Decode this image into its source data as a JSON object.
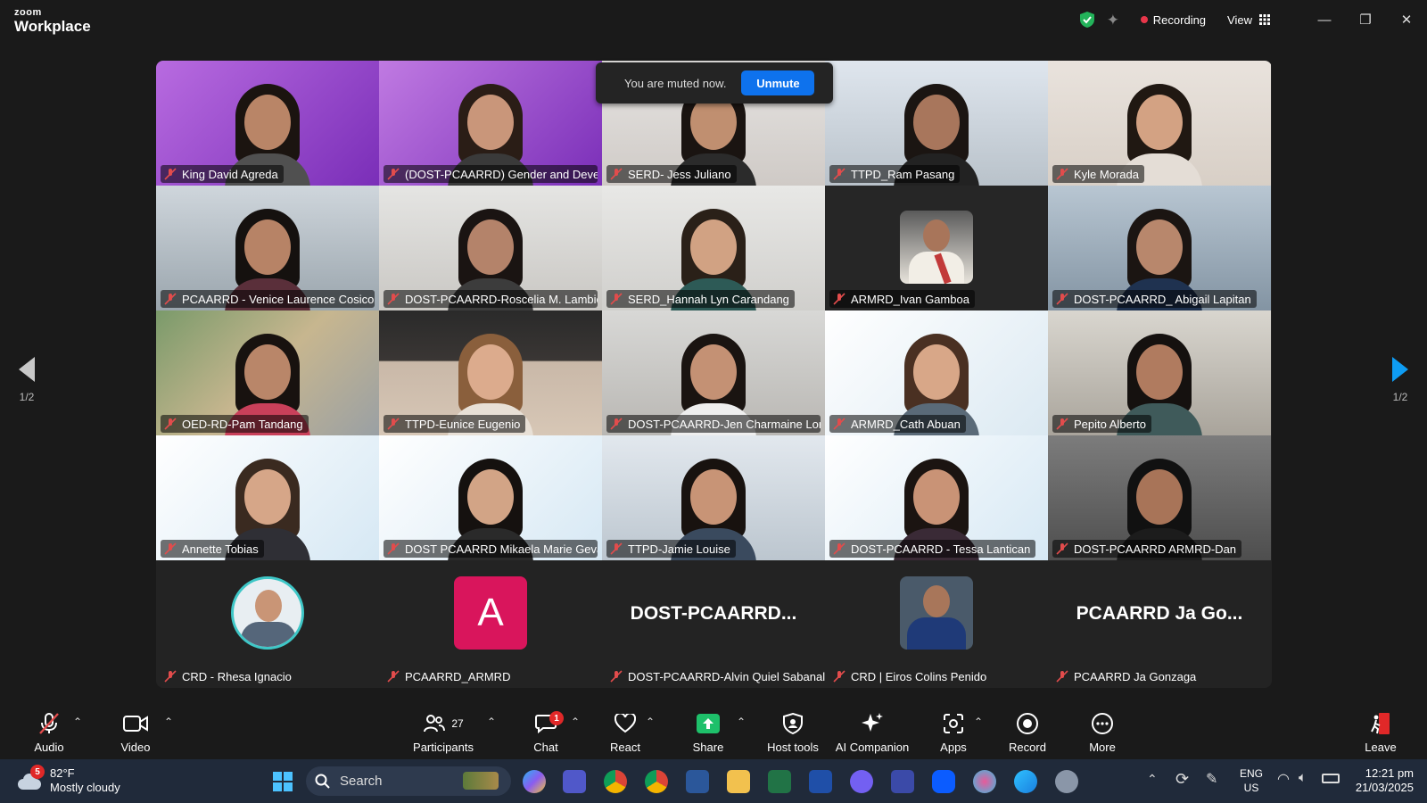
{
  "app": {
    "brand_top": "zoom",
    "brand_bottom": "Workplace",
    "recording_label": "Recording",
    "view_label": "View"
  },
  "toast": {
    "message": "You are muted now.",
    "unmute_label": "Unmute"
  },
  "pager": {
    "left_page": "1/2",
    "right_page": "1/2"
  },
  "participants": [
    {
      "name": "King David Agreda"
    },
    {
      "name": "(DOST-PCAARRD) Gender and Devel..."
    },
    {
      "name": "SERD- Jess Juliano"
    },
    {
      "name": "TTPD_Ram Pasang"
    },
    {
      "name": "Kyle Morada"
    },
    {
      "name": "PCAARRD - Venice Laurence Cosico"
    },
    {
      "name": "DOST-PCAARRD-Roscelia M. Lambio"
    },
    {
      "name": "SERD_Hannah Lyn Carandang"
    },
    {
      "name": "ARMRD_Ivan Gamboa"
    },
    {
      "name": "DOST-PCAARRD_ Abigail Lapitan"
    },
    {
      "name": "OED-RD-Pam Tandang"
    },
    {
      "name": "TTPD-Eunice Eugenio"
    },
    {
      "name": "DOST-PCAARRD-Jen Charmaine Lor..."
    },
    {
      "name": "ARMRD_Cath Abuan"
    },
    {
      "name": "Pepito Alberto"
    },
    {
      "name": "Annette Tobias"
    },
    {
      "name": "DOST PCAARRD Mikaela Marie Geva..."
    },
    {
      "name": "TTPD-Jamie Louise"
    },
    {
      "name": "DOST-PCAARRD - Tessa Lantican"
    },
    {
      "name": "DOST-PCAARRD ARMRD-Dan"
    }
  ],
  "bottom_participants": [
    {
      "name": "CRD - Rhesa Ignacio"
    },
    {
      "name": "PCAARRD_ARMRD",
      "avatar_letter": "A"
    },
    {
      "name": "DOST-PCAARRD-Alvin Quiel Sabanal",
      "display_name": "DOST-PCAARRD..."
    },
    {
      "name": "CRD | Eiros Colins Penido"
    },
    {
      "name": "PCAARRD Ja Gonzaga",
      "display_name": "PCAARRD Ja Go..."
    }
  ],
  "toolbar": {
    "audio": "Audio",
    "video": "Video",
    "participants": "Participants",
    "participants_count": "27",
    "chat": "Chat",
    "chat_badge": "1",
    "react": "React",
    "share": "Share",
    "host_tools": "Host tools",
    "ai_companion": "AI Companion",
    "apps": "Apps",
    "record": "Record",
    "more": "More",
    "leave": "Leave"
  },
  "taskbar": {
    "weather_badge": "5",
    "temperature": "82°F",
    "condition": "Mostly cloudy",
    "search_label": "Search",
    "language_top": "ENG",
    "language_bottom": "US",
    "time": "12:21 pm",
    "date": "21/03/2025"
  },
  "colors": {
    "accent_blue": "#0e72ed",
    "active_speaker": "#2ad49a",
    "recording_red": "#e8364a",
    "leave_red": "#e02828"
  }
}
